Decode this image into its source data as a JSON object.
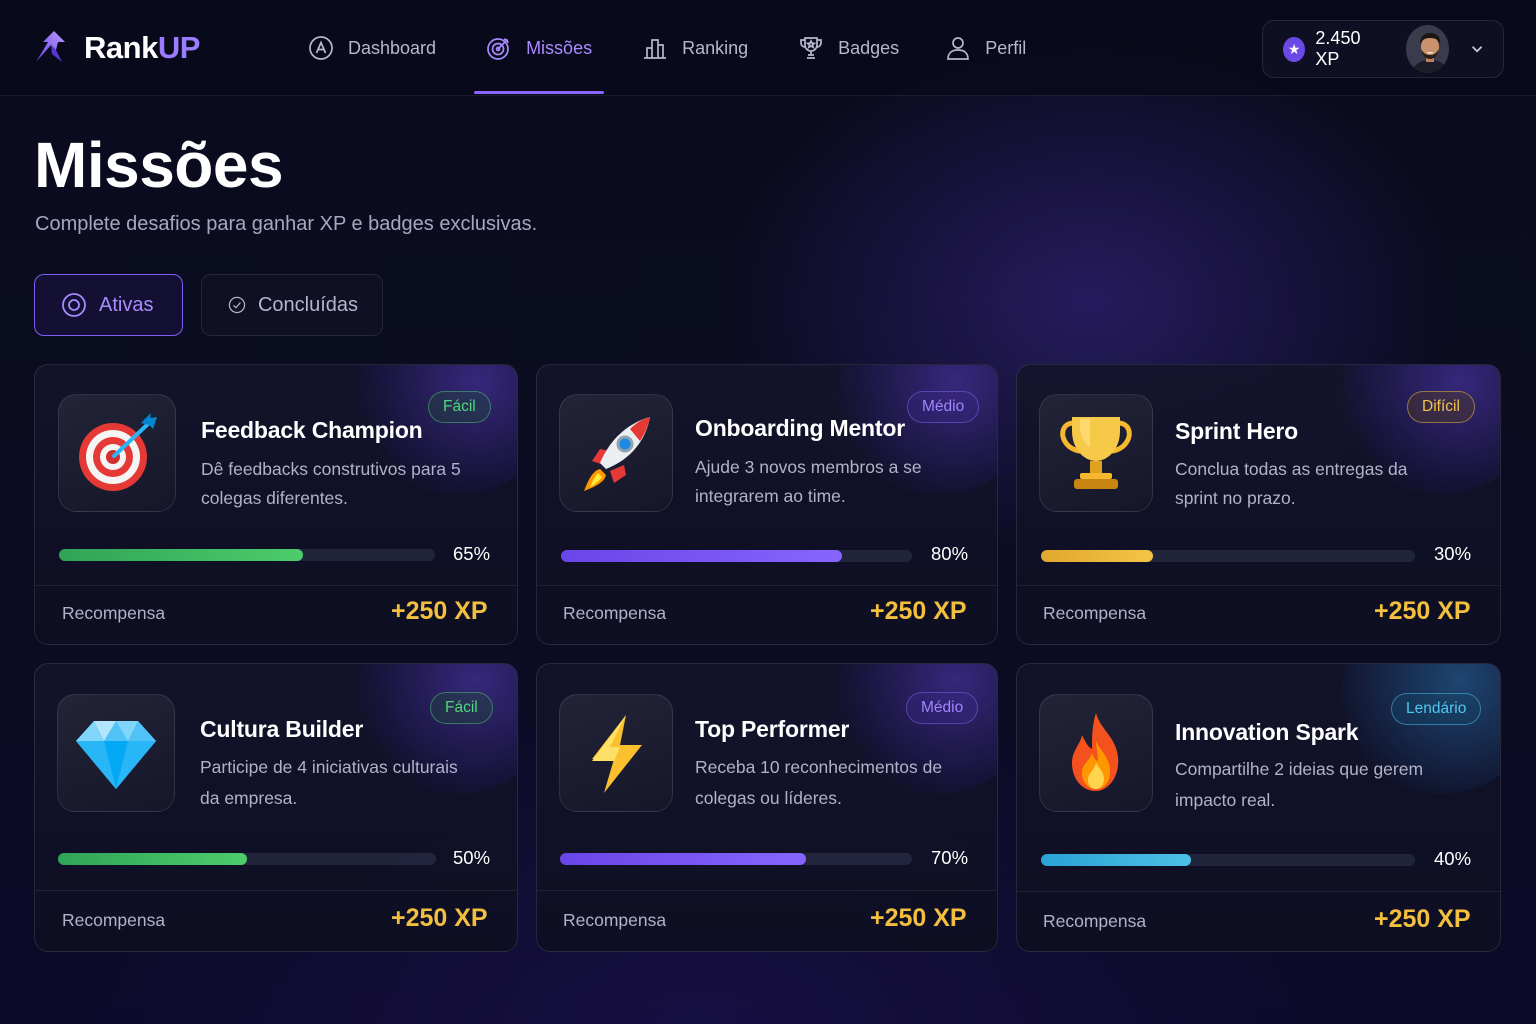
{
  "brand": {
    "name_main": "Rank",
    "name_accent": "UP"
  },
  "nav": {
    "items": [
      {
        "label": "Dashboard",
        "icon": "dashboard-icon"
      },
      {
        "label": "Missões",
        "icon": "target-icon",
        "active": true
      },
      {
        "label": "Ranking",
        "icon": "bar-chart-icon"
      },
      {
        "label": "Badges",
        "icon": "trophy-outline-icon"
      },
      {
        "label": "Perfil",
        "icon": "user-icon"
      }
    ]
  },
  "user": {
    "xp_total": "2.450 XP",
    "avatar": "user-avatar"
  },
  "page": {
    "title": "Missões",
    "subtitle": "Complete desafios para ganhar XP e badges exclusivas."
  },
  "tabs": [
    {
      "label": "Ativas",
      "active": true,
      "icon": "radio-target-icon"
    },
    {
      "label": "Concluídas",
      "active": false,
      "icon": "check-circle-icon"
    }
  ],
  "missions": [
    {
      "title": "Feedback Champion",
      "description": "Dê feedbacks construtivos para 5 colegas diferentes.",
      "difficulty": "Fácil",
      "progress": 65,
      "progress_label": "65%",
      "reward_label": "Recompensa",
      "reward": "+250 XP",
      "icon": "bullseye-dart-icon"
    },
    {
      "title": "Onboarding Mentor",
      "description": "Ajude 3 novos membros a se integrarem ao time.",
      "difficulty": "Médio",
      "progress": 80,
      "progress_label": "80%",
      "reward_label": "Recompensa",
      "reward": "+250 XP",
      "icon": "rocket-icon"
    },
    {
      "title": "Sprint Hero",
      "description": "Conclua todas as entregas da sprint no prazo.",
      "difficulty": "Difícil",
      "progress": 30,
      "progress_label": "30%",
      "reward_label": "Recompensa",
      "reward": "+250 XP",
      "icon": "trophy-icon"
    },
    {
      "title": "Cultura Builder",
      "description": "Participe de 4 iniciativas culturais da empresa.",
      "difficulty": "Fácil",
      "progress": 50,
      "progress_label": "50%",
      "reward_label": "Recompensa",
      "reward": "+250 XP",
      "icon": "diamond-icon"
    },
    {
      "title": "Top Performer",
      "description": "Receba 10 reconhecimentos de colegas ou líderes.",
      "difficulty": "Médio",
      "progress": 70,
      "progress_label": "70%",
      "reward_label": "Recompensa",
      "reward": "+250 XP",
      "icon": "lightning-icon"
    },
    {
      "title": "Innovation Spark",
      "description": "Compartilhe 2 ideias que gerem impacto real.",
      "difficulty": "Lendário",
      "progress": 40,
      "progress_label": "40%",
      "reward_label": "Recompensa",
      "reward": "+250 XP",
      "icon": "fire-icon"
    }
  ],
  "colors": {
    "accent": "#8b63ff",
    "reward": "#f3bf3f",
    "easy": "#4fd97a",
    "medium": "#9f86ff",
    "hard": "#f2c24a",
    "legendary": "#52c6f0"
  }
}
